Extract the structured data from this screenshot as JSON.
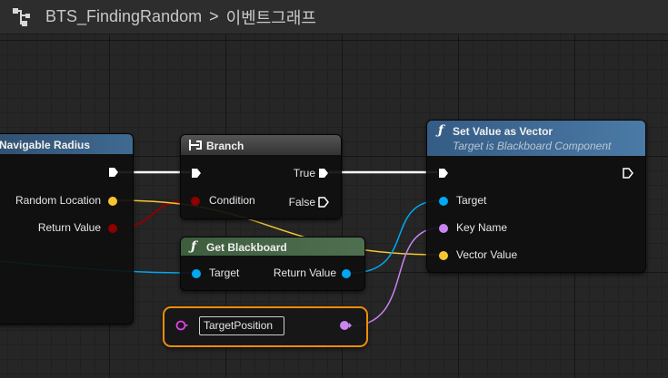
{
  "breadcrumb": {
    "graph_name": "BTS_FindingRandom",
    "separator": ">",
    "event_graph": "이벤트그래프"
  },
  "colors": {
    "exec": "#ffffff",
    "bool": "#8c0000",
    "vector": "#f7c631",
    "object": "#00a8f2",
    "name": "#c984f2",
    "selection": "#f08d0a",
    "header_node": "#2f4f6e",
    "header_function": "#3c6890",
    "header_pure": "#3b5a3b",
    "header_branch": "#3a3a3a"
  },
  "nodes": {
    "navigable": {
      "title": "Navigable Radius",
      "pins": {
        "random_location": "Random Location",
        "return_value": "Return Value"
      }
    },
    "branch": {
      "title": "Branch",
      "icon": "branch-icon",
      "pins": {
        "condition": "Condition",
        "true": "True",
        "false": "False"
      }
    },
    "get_blackboard": {
      "title": "Get Blackboard",
      "icon": "function-icon",
      "pins": {
        "target": "Target",
        "return_value": "Return Value"
      }
    },
    "set_value": {
      "title": "Set Value as Vector",
      "subtitle": "Target is Blackboard Component",
      "icon": "function-icon",
      "pins": {
        "target": "Target",
        "key_name": "Key Name",
        "vector_value": "Vector Value"
      }
    },
    "variable": {
      "name": "TargetPosition",
      "selected": true
    }
  }
}
